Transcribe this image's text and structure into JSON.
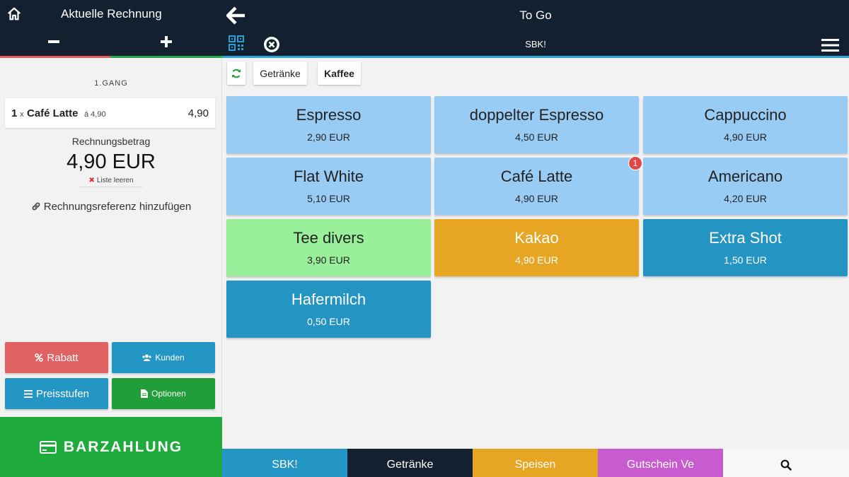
{
  "left_header": {
    "title": "Aktuelle Rechnung"
  },
  "right_header": {
    "title": "To Go",
    "subtitle": "SBK!"
  },
  "bill": {
    "course": "1.GANG",
    "items": [
      {
        "qty": "1",
        "x": "x",
        "name": "Café Latte",
        "unit_price": "á 4,90",
        "total": "4,90"
      }
    ],
    "total_label": "Rechnungsbetrag",
    "total_value": "4,90 EUR",
    "clear_label": "Liste leeren",
    "reference_label": "Rechnungsreferenz hinzufügen"
  },
  "actions": {
    "rabatt": "Rabatt",
    "kunden": "Kunden",
    "preisstufen": "Preisstufen",
    "optionen": "Optionen"
  },
  "payment": {
    "label": "BARZAHLUNG"
  },
  "categories": [
    "Getränke",
    "Kaffee"
  ],
  "products": [
    {
      "name": "Espresso",
      "price": "2,90 EUR"
    },
    {
      "name": "doppelter Espresso",
      "price": "4,50 EUR"
    },
    {
      "name": "Cappuccino",
      "price": "4,90 EUR"
    },
    {
      "name": "Flat White",
      "price": "5,10 EUR"
    },
    {
      "name": "Café Latte",
      "price": "4,90 EUR",
      "badge": "1"
    },
    {
      "name": "Americano",
      "price": "4,20 EUR"
    },
    {
      "name": "Tee divers",
      "price": "3,90 EUR"
    },
    {
      "name": "Kakao",
      "price": "4,90 EUR"
    },
    {
      "name": "Extra Shot",
      "price": "1,50 EUR"
    },
    {
      "name": "Hafermilch",
      "price": "0,50 EUR"
    }
  ],
  "bottom_tabs": [
    "SBK!",
    "Getränke",
    "Speisen",
    "Gutschein Ve"
  ],
  "colors": {
    "header": "#13202f",
    "accent_blue": "#2496c5",
    "light_blue": "#98ccf5",
    "green_tile": "#9af09a",
    "orange": "#e6a623",
    "pay_green": "#1fab3c",
    "rabatt_red": "#e16262",
    "purple": "#c85bcf"
  },
  "icons": [
    "home-icon",
    "minus-icon",
    "plus-icon",
    "back-arrow-icon",
    "qr-code-icon",
    "close-circle-icon",
    "hamburger-menu-icon",
    "refresh-icon",
    "link-icon",
    "percent-icon",
    "users-icon",
    "list-icon",
    "document-icon",
    "credit-card-icon",
    "search-icon"
  ]
}
